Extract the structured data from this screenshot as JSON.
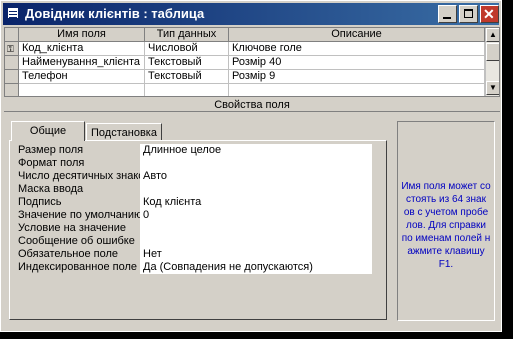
{
  "window": {
    "title": "Довідник клієнтів : таблица",
    "minimize_icon": "minimize-icon",
    "maximize_icon": "maximize-icon",
    "close_icon": "close-icon",
    "close_color": "#c0392b",
    "title_color": "#0a246a"
  },
  "grid": {
    "columns": [
      "Имя поля",
      "Тип данных",
      "Описание"
    ],
    "rows": [
      {
        "name": "Код_клієнта",
        "type": "Числовой",
        "description": "Ключовe голе",
        "primary_key": true
      },
      {
        "name": "Найменування_клієнта",
        "type": "Текстовый",
        "description": "Розмір 40"
      },
      {
        "name": "Телефон",
        "type": "Текстовый",
        "description": "Розмір 9"
      }
    ]
  },
  "properties": {
    "section_label": "Свойства поля",
    "tabs": [
      "Общие",
      "Подстановка"
    ],
    "active_tab": "Общие",
    "items": [
      {
        "label": "Размер поля",
        "value": "Длинное целое"
      },
      {
        "label": "Формат поля",
        "value": ""
      },
      {
        "label": "Число десятичных знаков",
        "value": "Авто"
      },
      {
        "label": "Маска ввода",
        "value": ""
      },
      {
        "label": "Подпись",
        "value": "Код клієнта"
      },
      {
        "label": "Значение по умолчанию",
        "value": "0"
      },
      {
        "label": "Условие на значение",
        "value": ""
      },
      {
        "label": "Сообщение об ошибке",
        "value": ""
      },
      {
        "label": "Обязательное поле",
        "value": "Нет"
      },
      {
        "label": "Индексированное поле",
        "value": "Да (Совпадения не допускаются)"
      }
    ]
  },
  "help": {
    "text": "Имя поля может со стоять из 64 знак ов с учетом пробе лов.  Для справки по именам полей н ажмите клавишу F1.",
    "color": "#0000c0"
  }
}
